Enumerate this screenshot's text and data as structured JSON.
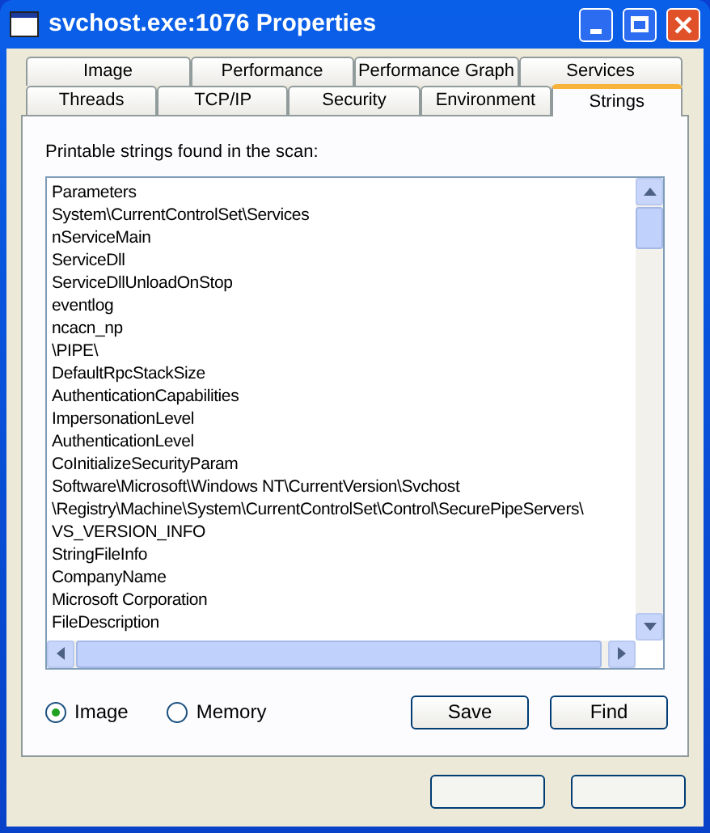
{
  "window": {
    "title": "svchost.exe:1076 Properties"
  },
  "tab_rows": [
    [
      {
        "label": "Image",
        "selected": false
      },
      {
        "label": "Performance",
        "selected": false
      },
      {
        "label": "Performance Graph",
        "selected": false
      },
      {
        "label": "Services",
        "selected": false
      }
    ],
    [
      {
        "label": "Threads",
        "selected": false
      },
      {
        "label": "TCP/IP",
        "selected": false
      },
      {
        "label": "Security",
        "selected": false
      },
      {
        "label": "Environment",
        "selected": false
      },
      {
        "label": "Strings",
        "selected": true
      }
    ]
  ],
  "caption": "Printable strings found in the scan:",
  "strings": [
    "Parameters",
    "System\\CurrentControlSet\\Services",
    "nServiceMain",
    "ServiceDll",
    "ServiceDllUnloadOnStop",
    "eventlog",
    "ncacn_np",
    "\\PIPE\\",
    "DefaultRpcStackSize",
    "AuthenticationCapabilities",
    "ImpersonationLevel",
    "AuthenticationLevel",
    "CoInitializeSecurityParam",
    "Software\\Microsoft\\Windows NT\\CurrentVersion\\Svchost",
    "\\Registry\\Machine\\System\\CurrentControlSet\\Control\\SecurePipeServers\\",
    "VS_VERSION_INFO",
    "StringFileInfo",
    "CompanyName",
    "Microsoft Corporation",
    "FileDescription"
  ],
  "source": [
    {
      "label": "Image",
      "selected": true
    },
    {
      "label": "Memory",
      "selected": false
    }
  ],
  "buttons": [
    "Save",
    "Find"
  ]
}
